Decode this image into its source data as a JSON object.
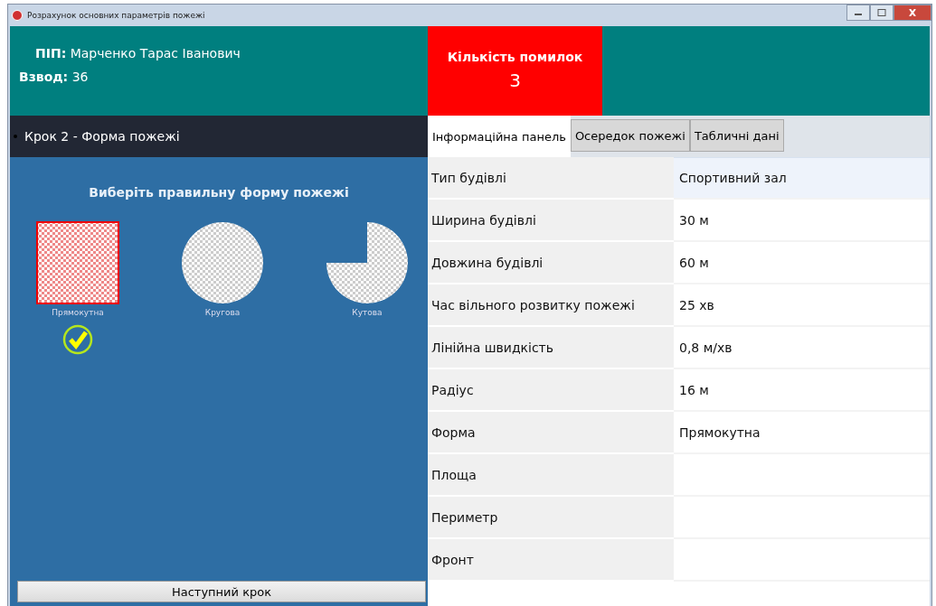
{
  "window": {
    "title": "Розрахунок основних параметрів пожежі"
  },
  "student": {
    "name_label": "ПІП:",
    "name": "Марченко Тарас Іванович",
    "platoon_label": "Взвод:",
    "platoon": "36"
  },
  "errors": {
    "label": "Кількість помилок",
    "count": "3"
  },
  "step": {
    "title": "Крок 2 - Форма пожежі",
    "prompt": "Виберіть правильну форму пожежі",
    "options": [
      {
        "kind": "rectangle",
        "label": "Прямокутна",
        "selected": true,
        "correct": true
      },
      {
        "kind": "circle",
        "label": "Кругова",
        "selected": false,
        "correct": false
      },
      {
        "kind": "sector",
        "label": "Кутова",
        "selected": false,
        "correct": false
      }
    ],
    "next_button": "Наступний крок"
  },
  "tabs": [
    {
      "label": "Інформаційна панель",
      "selected": true
    },
    {
      "label": "Осередок пожежі",
      "selected": false
    },
    {
      "label": "Табличні дані",
      "selected": false
    }
  ],
  "rows": [
    {
      "label": "Тип будівлі",
      "value": "Спортивний зал",
      "selected": true
    },
    {
      "label": "Ширина будівлі",
      "value": "30 м",
      "selected": false
    },
    {
      "label": "Довжина будівлі",
      "value": "60 м",
      "selected": false
    },
    {
      "label": "Час вільного розвитку пожежі",
      "value": "25 хв",
      "selected": false
    },
    {
      "label": "Лінійна швидкість",
      "value": "0,8 м/хв",
      "selected": false
    },
    {
      "label": "Радіус",
      "value": "16 м",
      "selected": false
    },
    {
      "label": "Форма",
      "value": "Прямокутна",
      "selected": false
    },
    {
      "label": "Площа",
      "selected": false
    },
    {
      "label": "Периметр",
      "selected": false
    },
    {
      "label": "Фронт",
      "selected": false
    }
  ]
}
